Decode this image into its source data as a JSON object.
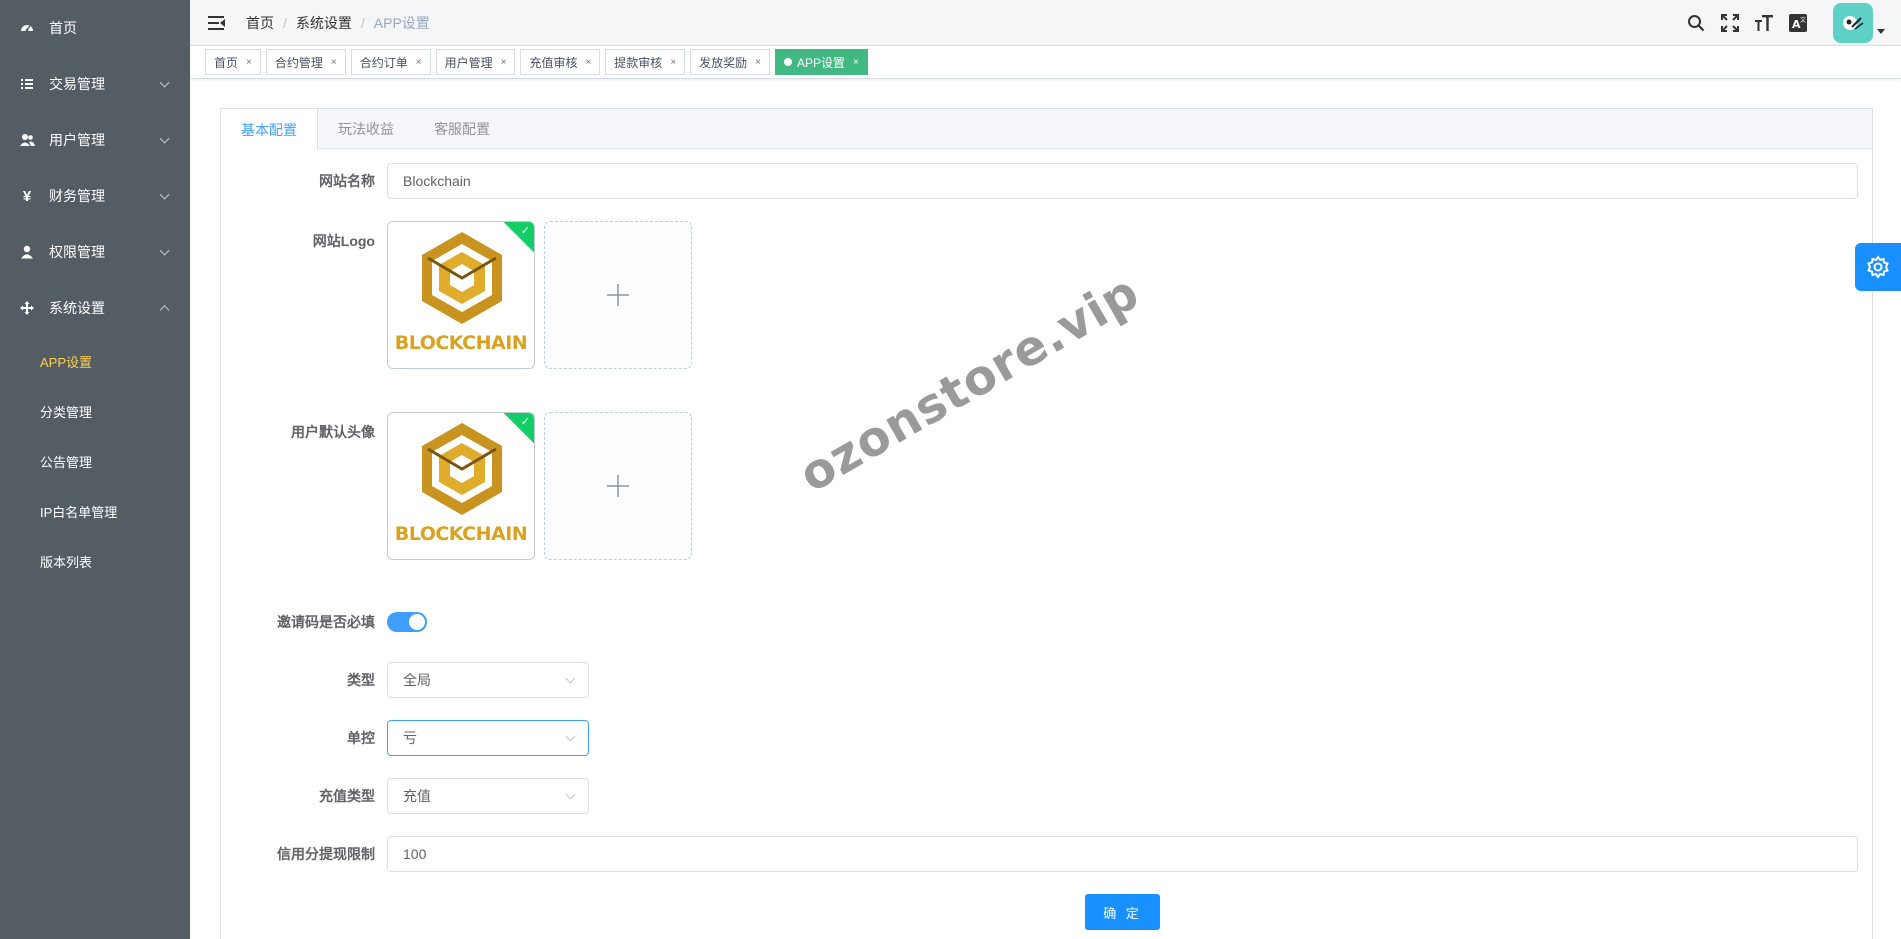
{
  "sidebar": {
    "items": [
      {
        "label": "首页",
        "icon": "dashboard-icon",
        "has_children": false
      },
      {
        "label": "交易管理",
        "icon": "list-icon",
        "has_children": true
      },
      {
        "label": "用户管理",
        "icon": "users-icon",
        "has_children": true
      },
      {
        "label": "财务管理",
        "icon": "yen-icon",
        "has_children": true
      },
      {
        "label": "权限管理",
        "icon": "user-icon",
        "has_children": true
      },
      {
        "label": "系统设置",
        "icon": "move-icon",
        "has_children": true,
        "expanded": true
      }
    ],
    "submenu": [
      {
        "label": "APP设置",
        "active": true
      },
      {
        "label": "分类管理"
      },
      {
        "label": "公告管理"
      },
      {
        "label": "IP白名单管理"
      },
      {
        "label": "版本列表"
      }
    ]
  },
  "header": {
    "breadcrumb": [
      "首页",
      "系统设置",
      "APP设置"
    ],
    "icons": [
      "search-icon",
      "fullscreen-icon",
      "font-size-icon",
      "translate-icon"
    ]
  },
  "tags": [
    {
      "label": "首页"
    },
    {
      "label": "合约管理"
    },
    {
      "label": "合约订单"
    },
    {
      "label": "用户管理"
    },
    {
      "label": "充值审核"
    },
    {
      "label": "提款审核"
    },
    {
      "label": "发放奖励"
    },
    {
      "label": "APP设置",
      "active": true
    }
  ],
  "tabs": [
    {
      "label": "基本配置",
      "active": true
    },
    {
      "label": "玩法收益"
    },
    {
      "label": "客服配置"
    }
  ],
  "form": {
    "site_name": {
      "label": "网站名称",
      "value": "Blockchain"
    },
    "site_logo": {
      "label": "网站Logo",
      "image_text": "BLOCKCHAIN"
    },
    "default_avatar": {
      "label": "用户默认头像",
      "image_text": "BLOCKCHAIN"
    },
    "invite_required": {
      "label": "邀请码是否必填",
      "on": true
    },
    "type": {
      "label": "类型",
      "value": "全局"
    },
    "single_control": {
      "label": "单控",
      "value": "亏"
    },
    "recharge_type": {
      "label": "充值类型",
      "value": "充值"
    },
    "credit_limit": {
      "label": "信用分提现限制",
      "value": "100"
    },
    "submit_label": "确 定"
  },
  "watermark": "ozonstore.vip",
  "colors": {
    "sidebar_bg": "#545c64",
    "sidebar_active": "#ffd04b",
    "primary": "#1890ff",
    "tag_active": "#42b983",
    "success": "#13ce66"
  }
}
